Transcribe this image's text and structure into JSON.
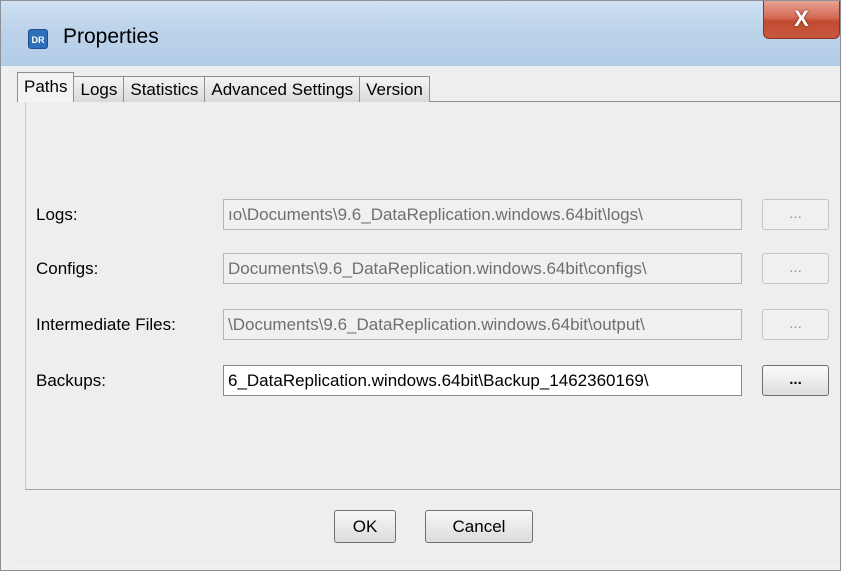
{
  "window": {
    "title": "Properties",
    "app_icon_text": "DR",
    "close_glyph": "X",
    "close_color": "#c8583f"
  },
  "tabs": [
    {
      "label": "Paths",
      "active": true
    },
    {
      "label": "Logs",
      "active": false
    },
    {
      "label": "Statistics",
      "active": false
    },
    {
      "label": "Advanced Settings",
      "active": false
    },
    {
      "label": "Version",
      "active": false
    }
  ],
  "paths": {
    "logs": {
      "label": "Logs:",
      "value": "ıo\\Documents\\9.6_DataReplication.windows.64bit\\logs\\",
      "enabled": false,
      "browse_label": "..."
    },
    "configs": {
      "label": "Configs:",
      "value": "Documents\\9.6_DataReplication.windows.64bit\\configs\\",
      "enabled": false,
      "browse_label": "..."
    },
    "intermediate": {
      "label": "Intermediate Files:",
      "value": "\\Documents\\9.6_DataReplication.windows.64bit\\output\\",
      "enabled": false,
      "browse_label": "..."
    },
    "backups": {
      "label": "Backups:",
      "value": "6_DataReplication.windows.64bit\\Backup_1462360169\\",
      "enabled": true,
      "browse_label": "..."
    }
  },
  "buttons": {
    "ok": "OK",
    "cancel": "Cancel"
  }
}
